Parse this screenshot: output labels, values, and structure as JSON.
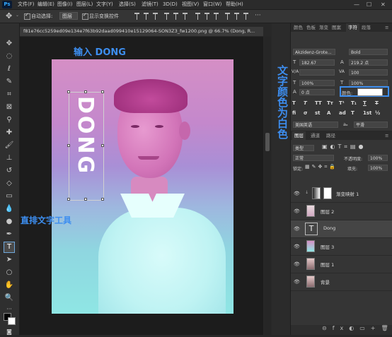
{
  "menubar": {
    "app_logo": "Ps",
    "items": [
      "文件(F)",
      "编辑(E)",
      "图像(I)",
      "图层(L)",
      "文字(Y)",
      "选择(S)",
      "滤镜(T)",
      "3D(D)",
      "视图(V)",
      "窗口(W)",
      "帮助(H)"
    ],
    "window_controls": [
      "—",
      "☐",
      "✕"
    ]
  },
  "options": {
    "auto_select_label": "自动选择:",
    "auto_select_value": "图层",
    "show_transform_label": "显示变换控件"
  },
  "document": {
    "tab_title": "f81e76cc5259ed09e134e7f63b92daad099410e15129064-SON3Z3_fw1200.png @ 66.7% (Dong, R...",
    "vertical_text": "DONG"
  },
  "annotations": {
    "input_dong": "输入 DONG",
    "vertical_text_tool": "直排文字工具",
    "text_color_white": "文字颜色为白色"
  },
  "character_panel": {
    "tabs": [
      "颜色",
      "色板",
      "渐变",
      "图案",
      "字符",
      "段落"
    ],
    "active_tab": "字符",
    "font_family": "Akzidenz-Grote...",
    "font_style": "Bold",
    "size": "182.67",
    "leading": "219.2 点",
    "kerning": "V/A",
    "tracking": "100",
    "vscale": "100%",
    "hscale": "100%",
    "baseline": "0 点",
    "color_label": "颜色:",
    "style_buttons": [
      "T",
      "T",
      "TT",
      "Tт",
      "T¹",
      "T₁",
      "T",
      "T"
    ],
    "extra_buttons": [
      "fi",
      "σ",
      "st",
      "A",
      "ad",
      "T",
      "1st",
      "½"
    ],
    "language": "美国英语",
    "aa_prefix": "aₐ",
    "antialias": "平滑"
  },
  "layers_panel": {
    "tabs": [
      "图层",
      "通道",
      "路径"
    ],
    "kind_filter": "类型",
    "blend_mode": "正常",
    "opacity_label": "不透明度:",
    "opacity_value": "100%",
    "lock_label": "锁定:",
    "fill_label": "填充:",
    "fill_value": "100%",
    "layers": [
      {
        "name": "渐变映射 1",
        "type": "adjustment",
        "selected": false
      },
      {
        "name": "图层 2",
        "type": "image",
        "selected": false
      },
      {
        "name": "Dong",
        "type": "text",
        "selected": true
      },
      {
        "name": "图层 3",
        "type": "gradient",
        "selected": false
      },
      {
        "name": "图层 1",
        "type": "image",
        "selected": false
      },
      {
        "name": "背景",
        "type": "image",
        "selected": false
      }
    ]
  },
  "colors": {
    "accent": "#3d8ef0",
    "panel_bg": "#353535",
    "canvas_top": "#d58fc5",
    "canvas_bottom": "#8fe6e4"
  }
}
